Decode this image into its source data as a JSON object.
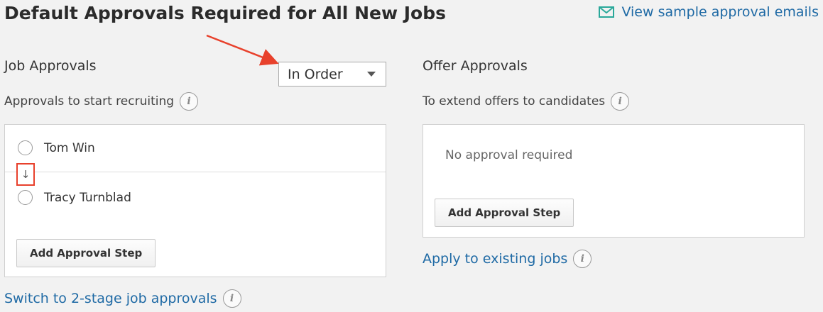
{
  "header": {
    "title": "Default Approvals Required for All New Jobs",
    "sample_link": "View sample approval emails"
  },
  "job_approvals": {
    "title": "Job Approvals",
    "order_select_value": "In Order",
    "subtitle": "Approvals to start recruiting",
    "approvers": [
      "Tom Win",
      "Tracy Turnblad"
    ],
    "order_arrow": "↓",
    "add_step_label": "Add Approval Step",
    "switch_link": "Switch to 2-stage job approvals"
  },
  "offer_approvals": {
    "title": "Offer Approvals",
    "subtitle": "To extend offers to candidates",
    "empty_text": "No approval required",
    "add_step_label": "Add Approval Step",
    "apply_link": "Apply to existing jobs"
  },
  "icons": {
    "info": "i",
    "email": "envelope-icon",
    "annotation_arrow": "red-arrow"
  },
  "colors": {
    "link": "#1f6aa5",
    "email_icon": "#2aa89a",
    "annotation": "#e8412c"
  }
}
